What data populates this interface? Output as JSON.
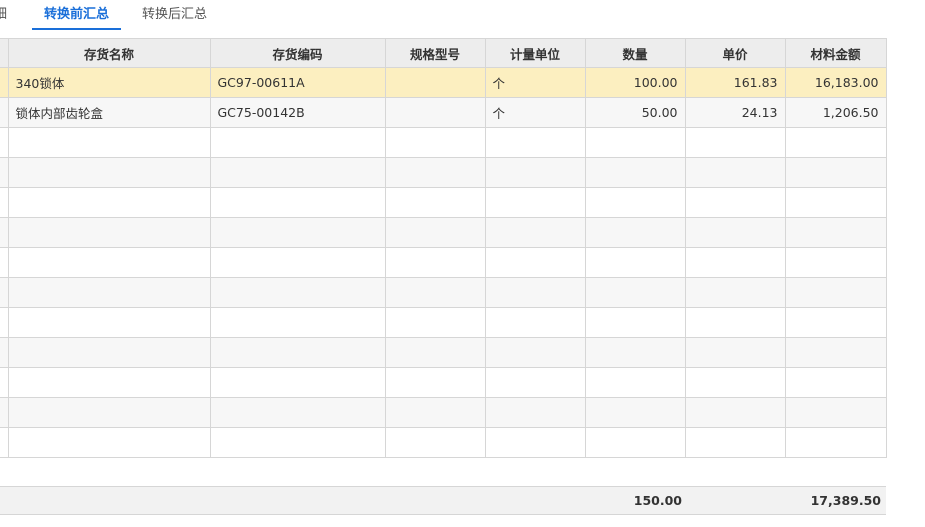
{
  "tabs": [
    {
      "label": "细"
    },
    {
      "label": "转换前汇总"
    },
    {
      "label": "转换后汇总"
    }
  ],
  "active_tab": "转换前汇总",
  "table": {
    "columns": [
      "",
      "存货名称",
      "存货编码",
      "规格型号",
      "计量单位",
      "数量",
      "单价",
      "材料金额"
    ],
    "rows": [
      {
        "name": "340锁体",
        "code": "GC97-00611A",
        "spec": "",
        "unit": "个",
        "qty": "100.00",
        "price": "161.83",
        "amount": "16,183.00"
      },
      {
        "name": "锁体内部齿轮盒",
        "code": "GC75-00142B",
        "spec": "",
        "unit": "个",
        "qty": "50.00",
        "price": "24.13",
        "amount": "1,206.50"
      }
    ],
    "empty_rows": 11
  },
  "footer": {
    "total_qty": "150.00",
    "total_amount": "17,389.50"
  },
  "colors": {
    "accent": "#1a6fd9",
    "selected_row": "#fcefc0",
    "header_bg": "#ededed"
  }
}
